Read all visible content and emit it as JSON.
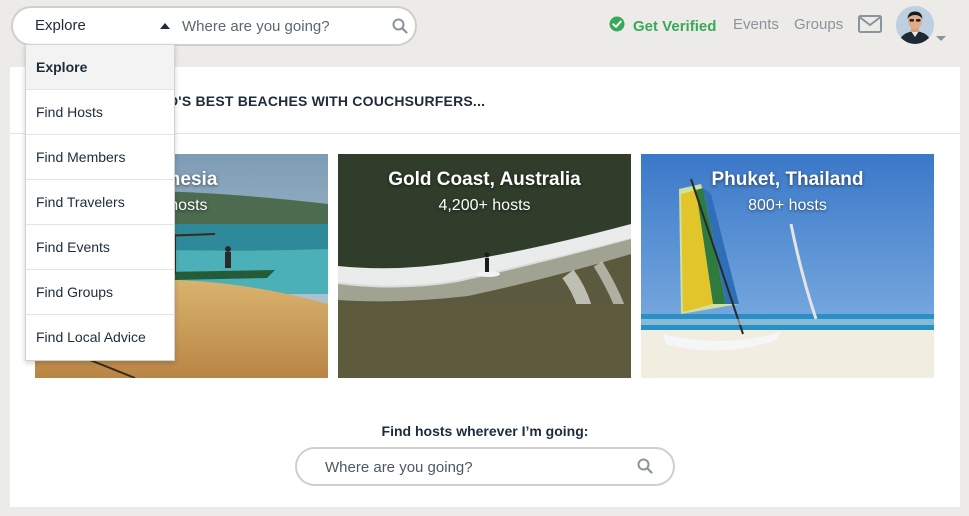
{
  "header": {
    "explore_label": "Explore",
    "search_placeholder": "Where are you going?",
    "verified_label": "Get Verified",
    "nav": [
      "Events",
      "Groups"
    ]
  },
  "dropdown": {
    "items": [
      "Explore",
      "Find Hosts",
      "Find Members",
      "Find Travelers",
      "Find Events",
      "Find Groups",
      "Find Local Advice"
    ]
  },
  "main": {
    "title": "D'S BEST BEACHES WITH COUCHSURFERS...",
    "destinations": [
      {
        "name": "donesia",
        "hosts": "+ hosts"
      },
      {
        "name": "Gold Coast, Australia",
        "hosts": "4,200+ hosts"
      },
      {
        "name": "Phuket, Thailand",
        "hosts": "800+ hosts"
      }
    ],
    "find_label": "Find hosts wherever I’m going:",
    "search_placeholder": "Where are you going?"
  },
  "colors": {
    "accent_green": "#3aa85a",
    "text_dark": "#1d2b3a",
    "muted": "#8a949c"
  },
  "icons": [
    "search-icon",
    "check-circle-icon",
    "mail-icon",
    "avatar",
    "caret-up-icon",
    "caret-down-icon"
  ]
}
